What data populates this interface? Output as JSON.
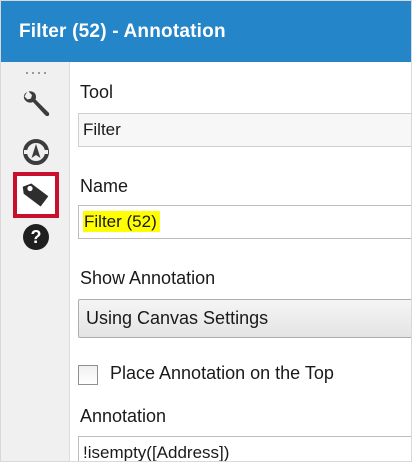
{
  "window": {
    "title": "Filter (52) - Annotation"
  },
  "sidebar": {
    "items": [
      {
        "icon": "wrench-icon"
      },
      {
        "icon": "compass-icon"
      },
      {
        "icon": "tag-icon",
        "selected": true
      },
      {
        "icon": "help-icon"
      }
    ],
    "selected_border_color": "#c8102e"
  },
  "form": {
    "tool": {
      "label": "Tool",
      "value": "Filter"
    },
    "name": {
      "label": "Name",
      "value": "Filter (52)",
      "highlight_color": "#ffff00"
    },
    "show_annotation": {
      "label": "Show Annotation",
      "selected": "Using Canvas Settings"
    },
    "place_on_top": {
      "label": "Place Annotation on the Top",
      "checked": false
    },
    "annotation": {
      "label": "Annotation",
      "value": "!isempty([Address])"
    }
  },
  "colors": {
    "titlebar": "#2585c9",
    "sidebar_bg": "#f0f0f0"
  }
}
